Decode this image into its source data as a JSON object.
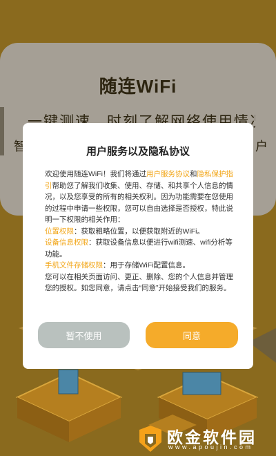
{
  "background": {
    "app_title": "随连WiFi",
    "subtitle": "一键测速，时刻了解网络使用情况",
    "subtitle_left_char": "智",
    "subtitle_right_char": "户"
  },
  "dialog": {
    "title": "用户服务以及隐私协议",
    "intro_1": "欢迎使用随连WiFi！我们将通过",
    "link_user_agreement": "用户服务协议",
    "and": "和",
    "link_privacy": "隐私保护指引",
    "intro_2": "帮助您了解我们收集、使用、存储、和共享个人信息的情况，以及您享受的所有的相关权利。因为功能需要在您使用的过程中申请一些权限，您可以自由选择是否授权，特此说明一下权限的相关作用：",
    "perm_location_label": "位置权限",
    "perm_location_desc": "：获取粗略位置，以便获取附近的WiFi。",
    "perm_device_label": "设备信息权限",
    "perm_device_desc": "：获取设备信息以便进行wifi测速、wifi分析等功能。",
    "perm_storage_label": "手机文件存储权限",
    "perm_storage_desc": "：用于存储WiFi配置信息。",
    "outro": "您可以在相关页面访问、更正、删除、您的个人信息并管理您的授权。如您同意，请点击“同意”开始接受我们的服务。",
    "decline_label": "暂不使用",
    "agree_label": "同意"
  },
  "watermark": {
    "brand": "欧金软件园",
    "url": "www.apoujin.com"
  },
  "colors": {
    "accent": "#f5ab2a",
    "link": "#f2a516",
    "decline_button": "#b9c1be",
    "background": "#8a6a1e"
  }
}
